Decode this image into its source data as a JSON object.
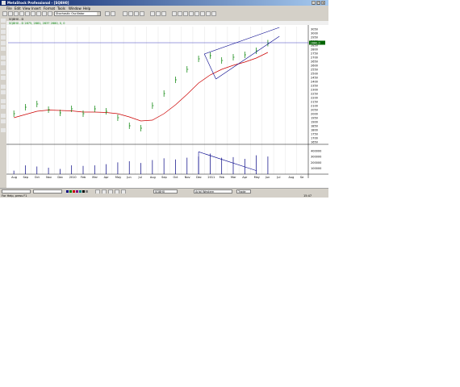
{
  "app": {
    "title": "MetaStock Professional - [SQ8H0]"
  },
  "menu": [
    "File",
    "Edit",
    "View",
    "Insert",
    "Format",
    "Tools",
    "Window",
    "Help"
  ],
  "toolbar": {
    "indicator_select": "Stochastic Oscillator"
  },
  "chart_window": {
    "title": "SQ8H0 - D",
    "legend": "SQ8H0 - D 2875, 2881, 2837 2880, 0, 0"
  },
  "status": {
    "symbol_field": "SQ8H0",
    "font_field": "Arial Western",
    "zoom_field": "Trade"
  },
  "taskbar": {
    "left": "For Help, press F1",
    "right": "15:47"
  },
  "colors": {
    "bars": "#008000",
    "ma": "#cc0000",
    "trendline": "#00008b",
    "hline": "#4040c0",
    "volume": "#000080"
  },
  "chart_data": {
    "type": "bar",
    "price": {
      "x": [
        "Aug",
        "Sep",
        "Oct",
        "Nov",
        "Dec",
        "2010",
        "Feb",
        "Mar",
        "Apr",
        "May",
        "Jun",
        "Jul",
        "Aug",
        "Sep",
        "Oct",
        "Nov",
        "Dec",
        "2011",
        "Feb",
        "Mar",
        "Apr",
        "May",
        "Jun",
        "Jul",
        "Aug",
        "Se"
      ],
      "close": [
        2000,
        2080,
        2120,
        2050,
        2010,
        2060,
        2000,
        2060,
        2030,
        1950,
        1850,
        1820,
        2100,
        2250,
        2420,
        2550,
        2680,
        2720,
        2660,
        2700,
        2730,
        2780,
        2875,
        null,
        null,
        null
      ],
      "ma": [
        1950,
        1990,
        2030,
        2045,
        2040,
        2035,
        2020,
        2020,
        2015,
        2000,
        1960,
        1910,
        1920,
        2000,
        2110,
        2240,
        2380,
        2480,
        2550,
        2600,
        2640,
        2690,
        2760,
        null,
        null,
        null
      ],
      "ylim": [
        1650,
        3080
      ],
      "yticks": [
        3050,
        3000,
        2950,
        2900,
        2850,
        2800,
        2750,
        2700,
        2650,
        2600,
        2550,
        2500,
        2450,
        2400,
        2350,
        2300,
        2250,
        2200,
        2150,
        2100,
        2050,
        2000,
        1950,
        1900,
        1850,
        1800,
        1750,
        1700,
        1650
      ],
      "hline": 2880,
      "last": "2880.0"
    },
    "volume": {
      "values": [
        60,
        150,
        130,
        110,
        90,
        150,
        140,
        150,
        170,
        200,
        220,
        190,
        240,
        270,
        250,
        280,
        300,
        350,
        280,
        290,
        260,
        320,
        300,
        null,
        null,
        null
      ],
      "ylim": [
        0,
        480
      ],
      "yticks": [
        400000,
        300000,
        200000,
        100000
      ]
    }
  }
}
